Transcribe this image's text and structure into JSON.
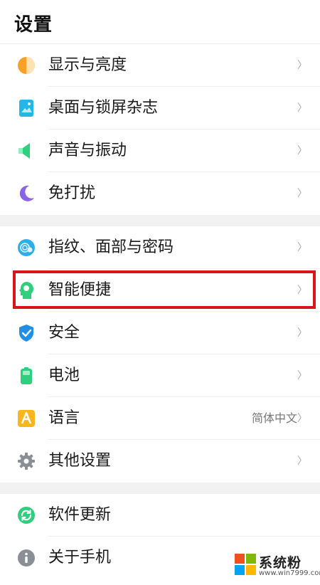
{
  "header": {
    "title": "设置"
  },
  "groups": [
    {
      "items": [
        {
          "label": "显示与亮度",
          "icon": "display-brightness-icon"
        },
        {
          "label": "桌面与锁屏杂志",
          "icon": "wallpaper-icon"
        },
        {
          "label": "声音与振动",
          "icon": "sound-icon"
        },
        {
          "label": "免打扰",
          "icon": "do-not-disturb-moon-icon"
        }
      ]
    },
    {
      "items": [
        {
          "label": "指纹、面部与密码",
          "icon": "fingerprint-icon"
        },
        {
          "label": "智能便捷",
          "icon": "smart-assist-icon",
          "highlighted": true
        },
        {
          "label": "安全",
          "icon": "security-shield-icon"
        },
        {
          "label": "电池",
          "icon": "battery-icon"
        },
        {
          "label": "语言",
          "icon": "language-icon",
          "value": "简体中文"
        },
        {
          "label": "其他设置",
          "icon": "gear-icon"
        }
      ]
    },
    {
      "items": [
        {
          "label": "软件更新",
          "icon": "software-update-icon"
        },
        {
          "label": "关于手机",
          "icon": "info-icon"
        }
      ]
    }
  ],
  "chevron": "〉",
  "colors": {
    "highlight_border": "#d7161b",
    "section_gap": "#f2f2f2",
    "divider": "#eeeeee"
  },
  "watermark": {
    "title": "系统粉",
    "url": "www.win7999.com"
  }
}
